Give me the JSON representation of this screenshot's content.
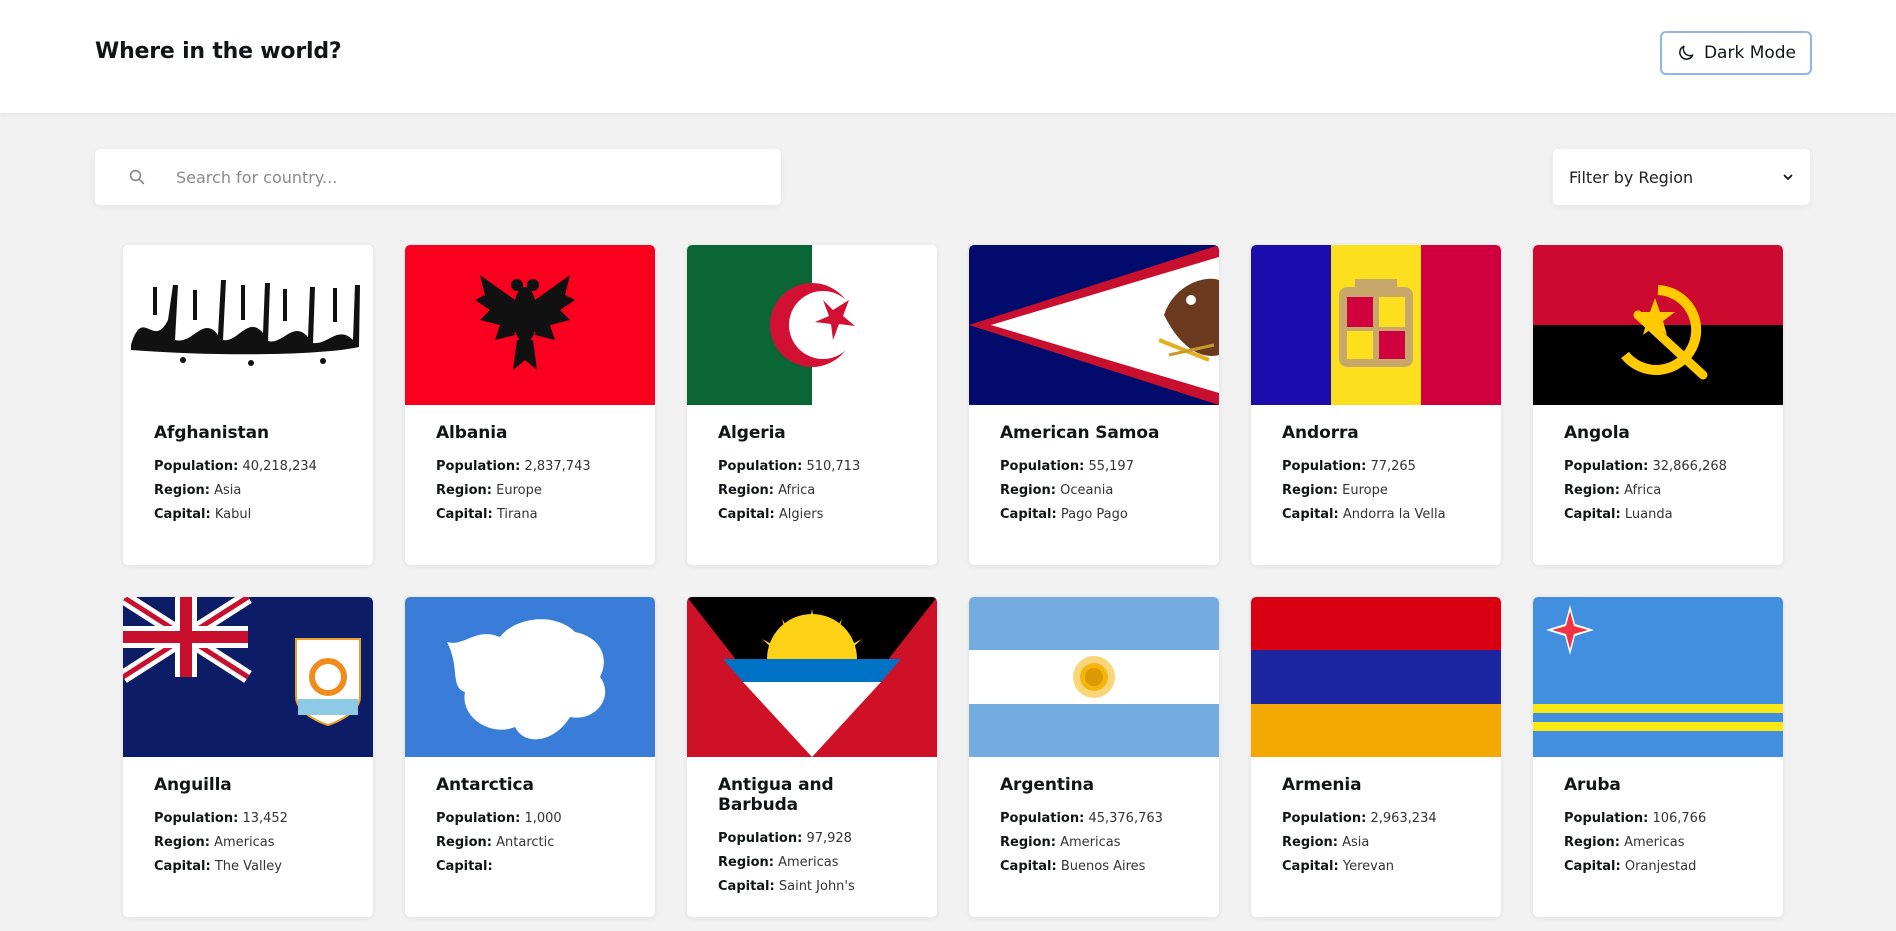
{
  "header": {
    "title": "Where in the world?",
    "mode_label": "Dark Mode",
    "mode_icon": "moon-icon"
  },
  "search": {
    "placeholder": "Search for country...",
    "value": ""
  },
  "filter": {
    "label": "Filter by Region"
  },
  "labels": {
    "population": "Population:",
    "region": "Region:",
    "capital": "Capital:"
  },
  "countries": [
    {
      "name": "Afghanistan",
      "population": "40,218,234",
      "region": "Asia",
      "capital": "Kabul"
    },
    {
      "name": "Albania",
      "population": "2,837,743",
      "region": "Europe",
      "capital": "Tirana"
    },
    {
      "name": "Algeria",
      "population": "510,713",
      "region": "Africa",
      "capital": "Algiers"
    },
    {
      "name": "American Samoa",
      "population": "55,197",
      "region": "Oceania",
      "capital": "Pago Pago"
    },
    {
      "name": "Andorra",
      "population": "77,265",
      "region": "Europe",
      "capital": "Andorra la Vella"
    },
    {
      "name": "Angola",
      "population": "32,866,268",
      "region": "Africa",
      "capital": "Luanda"
    },
    {
      "name": "Anguilla",
      "population": "13,452",
      "region": "Americas",
      "capital": "The Valley"
    },
    {
      "name": "Antarctica",
      "population": "1,000",
      "region": "Antarctic",
      "capital": ""
    },
    {
      "name": "Antigua and Barbuda",
      "population": "97,928",
      "region": "Americas",
      "capital": "Saint John's"
    },
    {
      "name": "Argentina",
      "population": "45,376,763",
      "region": "Americas",
      "capital": "Buenos Aires"
    },
    {
      "name": "Armenia",
      "population": "2,963,234",
      "region": "Asia",
      "capital": "Yerevan"
    },
    {
      "name": "Aruba",
      "population": "106,766",
      "region": "Americas",
      "capital": "Oranjestad"
    }
  ]
}
